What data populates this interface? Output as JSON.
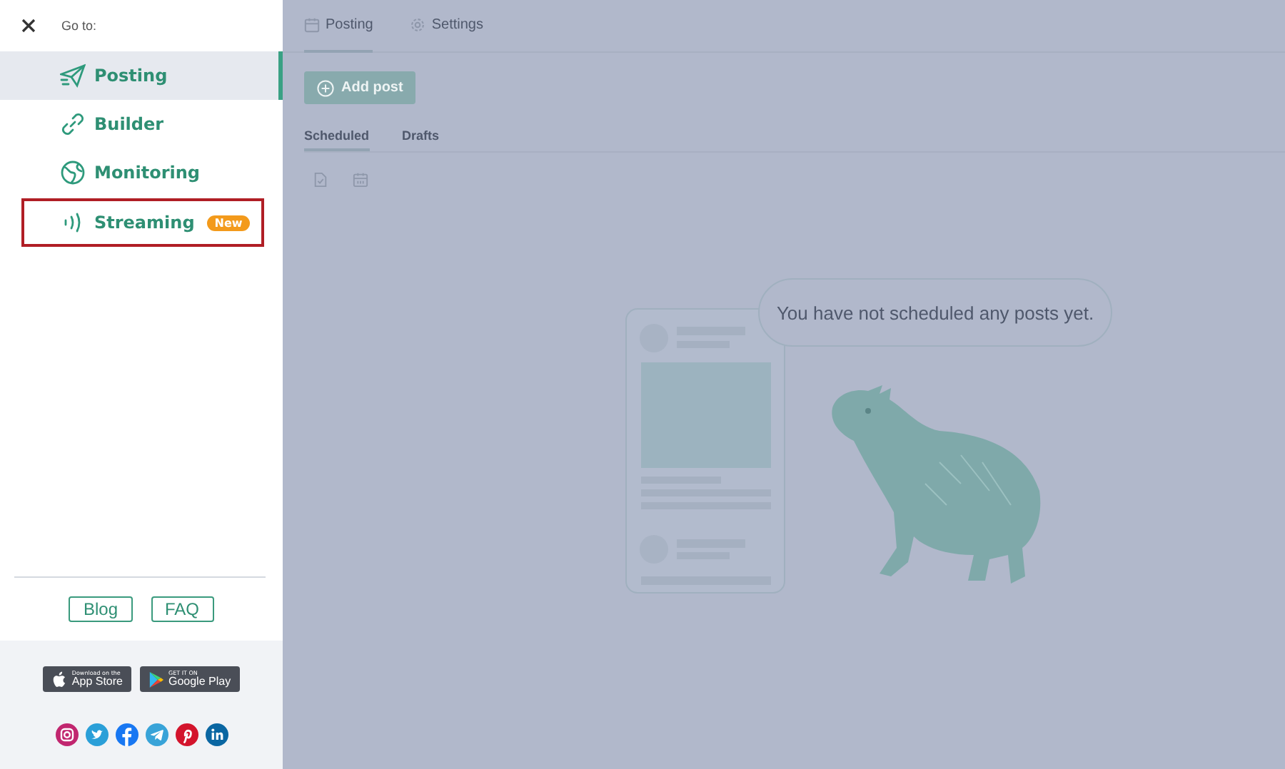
{
  "sidebar": {
    "label": "Go to:",
    "items": [
      {
        "label": "Posting",
        "kind": "plane",
        "selected": true,
        "highlighted": false
      },
      {
        "label": "Builder",
        "kind": "link",
        "selected": false,
        "highlighted": false
      },
      {
        "label": "Monitoring",
        "kind": "globe",
        "selected": false,
        "highlighted": false
      },
      {
        "label": "Streaming",
        "kind": "waves",
        "selected": false,
        "highlighted": true,
        "badge": "New"
      }
    ],
    "links": [
      "Blog",
      "FAQ"
    ],
    "store_badges": [
      {
        "kind": "apple",
        "small": "Download on the",
        "big": "App Store"
      },
      {
        "kind": "google",
        "small": "GET IT ON",
        "big": "Google Play"
      }
    ],
    "social": [
      {
        "kind": "instagram",
        "color": "#c1266f"
      },
      {
        "kind": "twitter",
        "color": "#2a9fd8"
      },
      {
        "kind": "facebook",
        "color": "#1877f2"
      },
      {
        "kind": "telegram",
        "color": "#38a3d8"
      },
      {
        "kind": "pinterest",
        "color": "#d3142c"
      },
      {
        "kind": "linkedin",
        "color": "#0a66a2"
      }
    ]
  },
  "main": {
    "tabs": [
      {
        "label": "Posting",
        "kind": "calendar",
        "selected": true
      },
      {
        "label": "Settings",
        "kind": "gear",
        "selected": false
      }
    ],
    "add_button": "Add post",
    "subtabs": [
      {
        "label": "Scheduled",
        "selected": true
      },
      {
        "label": "Drafts",
        "selected": false
      }
    ],
    "view_icons": [
      {
        "kind": "document"
      },
      {
        "kind": "calendar"
      }
    ],
    "empty_message": "You have not scheduled any posts yet."
  }
}
